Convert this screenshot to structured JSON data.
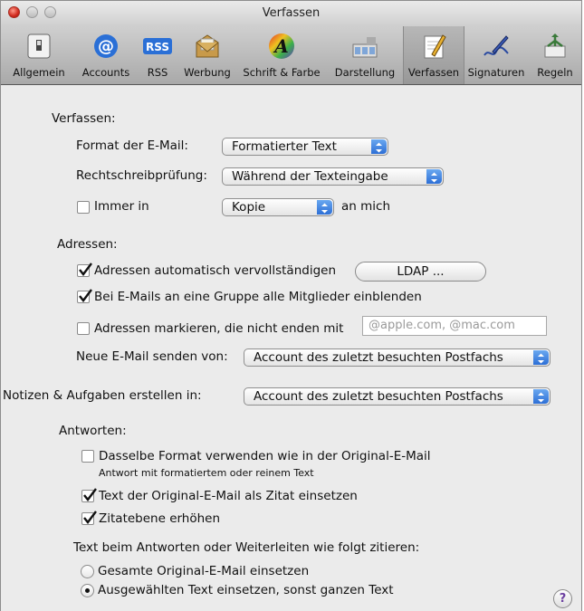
{
  "window": {
    "title": "Verfassen"
  },
  "toolbar": {
    "items": [
      {
        "label": "Allgemein",
        "icon": "switch-icon"
      },
      {
        "label": "Accounts",
        "icon": "at-sign-icon"
      },
      {
        "label": "RSS",
        "icon": "rss-icon"
      },
      {
        "label": "Werbung",
        "icon": "junk-mail-icon"
      },
      {
        "label": "Schrift & Farbe",
        "icon": "font-color-icon"
      },
      {
        "label": "Darstellung",
        "icon": "viewing-icon"
      },
      {
        "label": "Verfassen",
        "icon": "compose-icon",
        "selected": true
      },
      {
        "label": "Signaturen",
        "icon": "signature-icon"
      },
      {
        "label": "Regeln",
        "icon": "rules-icon"
      }
    ]
  },
  "compose": {
    "heading": "Verfassen:",
    "format_label": "Format der E-Mail:",
    "format_value": "Formatierter Text",
    "spell_label": "Rechtschreibprüfung:",
    "spell_value": "Während der Texteingabe",
    "always_label": "Immer in",
    "always_checked": false,
    "always_value": "Kopie",
    "always_suffix": "an mich"
  },
  "addresses": {
    "heading": "Adressen:",
    "autocomplete_label": "Adressen automatisch vervollständigen",
    "autocomplete_checked": true,
    "ldap_button": "LDAP ...",
    "group_label": "Bei E-Mails an eine Gruppe alle Mitglieder einblenden",
    "group_checked": true,
    "mark_label": "Adressen markieren, die nicht enden mit",
    "mark_checked": false,
    "mark_placeholder": "@apple.com, @mac.com",
    "send_from_label": "Neue E-Mail senden von:",
    "send_from_value": "Account des zuletzt besuchten Postfachs"
  },
  "notes": {
    "label": "Notizen & Aufgaben erstellen in:",
    "value": "Account des zuletzt besuchten Postfachs"
  },
  "replies": {
    "heading": "Antworten:",
    "same_format_label": "Dasselbe Format verwenden wie in der Original-E-Mail",
    "same_format_checked": false,
    "same_format_hint": "Antwort mit formatiertem oder reinem Text",
    "quote_label": "Text der Original-E-Mail als Zitat einsetzen",
    "quote_checked": true,
    "increase_label": "Zitatebene erhöhen",
    "increase_checked": true,
    "quote_mode_label": "Text beim Antworten oder Weiterleiten wie folgt zitieren:",
    "option_all": "Gesamte Original-E-Mail einsetzen",
    "option_selected": "Ausgewählten Text einsetzen, sonst ganzen Text",
    "selected_option": "option_selected"
  },
  "help": {
    "label": "?"
  }
}
